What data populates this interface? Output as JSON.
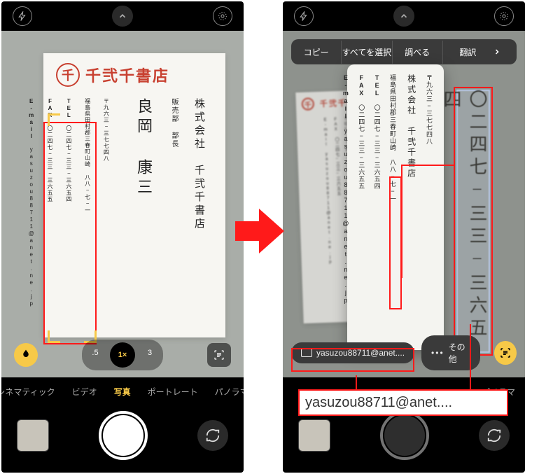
{
  "card": {
    "logo_char": "千",
    "store_name": "千弐千書店",
    "company_line": "株式会社　千弐千書店",
    "title_line": "販売部　部長",
    "person_name": "良岡 康三",
    "address": "福島県田村郡三春町山崎 八八−七−一",
    "postal": "〒九六三−三七七四八",
    "tel_label": "TEL",
    "tel": "〇二四七−三三−三六五四",
    "fax_label": "FAX",
    "fax": "〇二四七−三三−三六五五",
    "email_label": "E-mail",
    "email": "yasuzou88711@anet.ne.jp"
  },
  "camera": {
    "zoom": {
      "wide": ".5",
      "main": "1×",
      "tele": "3"
    },
    "modes": [
      "シネマティック",
      "ビデオ",
      "写真",
      "ポートレート",
      "パノラマ"
    ],
    "active_mode_index": 2
  },
  "action_menu": {
    "items": [
      "コピー",
      "すべてを選択",
      "調べる",
      "翻訳"
    ]
  },
  "chips": {
    "email_chip": "yasuzou88711@anet....",
    "other_chip": "その他"
  },
  "selected_big": "〇二四七−三三−三六五四",
  "email_overlay": "yasuzou88711@anet...."
}
